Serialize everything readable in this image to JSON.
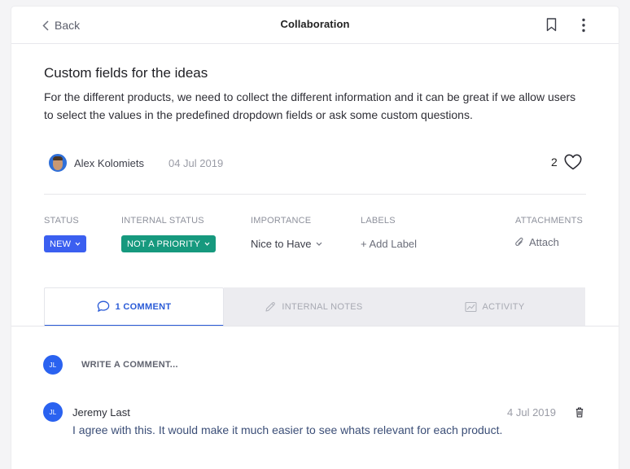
{
  "header": {
    "back_label": "Back",
    "title": "Collaboration"
  },
  "idea": {
    "title": "Custom fields for the ideas",
    "description": "For the different products, we need to collect the different information and it can be great if we allow users to select the values in the predefined dropdown fields or ask some custom questions.",
    "author": "Alex Kolomiets",
    "date": "04 Jul 2019",
    "like_count": "2"
  },
  "properties": {
    "status": {
      "label": "STATUS",
      "value": "NEW",
      "color": "#3b5ff0"
    },
    "internal_status": {
      "label": "INTERNAL STATUS",
      "value": "NOT A PRIORITY",
      "color": "#16997e"
    },
    "importance": {
      "label": "IMPORTANCE",
      "value": "Nice to Have"
    },
    "labels": {
      "label": "LABELS",
      "value": "+ Add Label"
    },
    "attachments": {
      "label": "ATTACHMENTS",
      "value": "Attach"
    }
  },
  "tabs": [
    {
      "label": "1 COMMENT",
      "icon": "comment-icon",
      "active": true
    },
    {
      "label": "INTERNAL NOTES",
      "icon": "pencil-icon",
      "active": false
    },
    {
      "label": "ACTIVITY",
      "icon": "activity-icon",
      "active": false
    }
  ],
  "composer": {
    "avatar_initials": "JL",
    "placeholder": "WRITE A COMMENT..."
  },
  "comments": [
    {
      "avatar_initials": "JL",
      "author": "Jeremy Last",
      "date": "4 Jul 2019",
      "text": "I agree with this. It would make it much easier to see whats relevant for each product."
    }
  ],
  "colors": {
    "accent": "#2a5bd7",
    "avatar": "#2a62f0"
  }
}
